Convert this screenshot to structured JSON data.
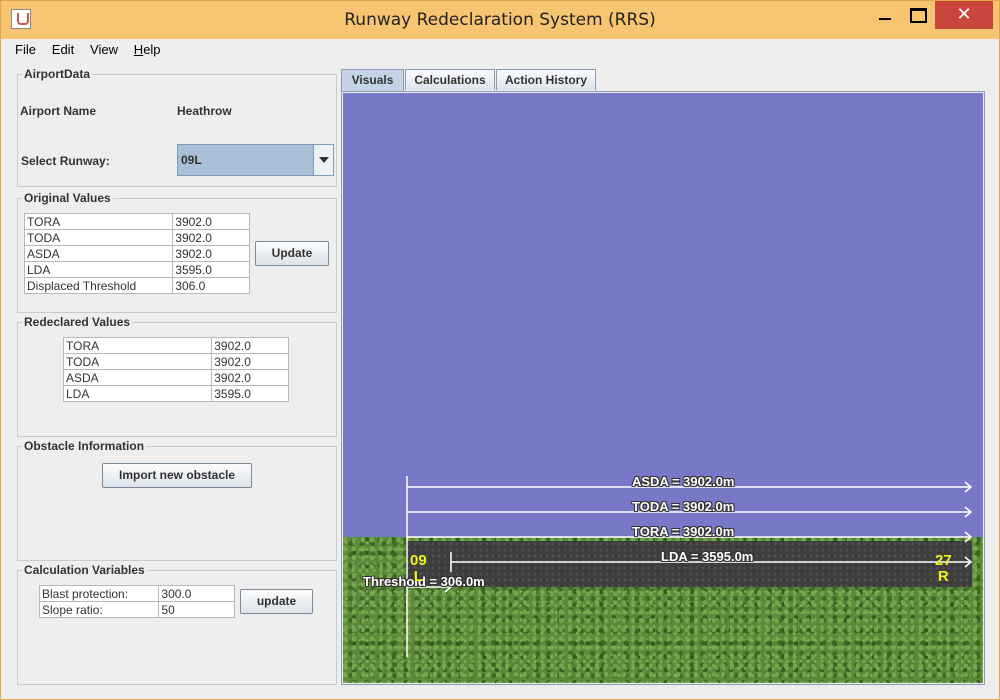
{
  "window": {
    "title": "Runway Redeclaration System (RRS)",
    "close_glyph": "✕"
  },
  "menu": [
    "File",
    "Edit",
    "View",
    "Help"
  ],
  "airport": {
    "legend": "AirportData",
    "name_label": "Airport Name",
    "name_value": "Heathrow",
    "runway_label": "Select Runway:",
    "runway_selected": "09L"
  },
  "original": {
    "legend": "Original Values",
    "rows": [
      {
        "k": "TORA",
        "v": "3902.0"
      },
      {
        "k": "TODA",
        "v": "3902.0"
      },
      {
        "k": "ASDA",
        "v": "3902.0"
      },
      {
        "k": "LDA",
        "v": "3595.0"
      },
      {
        "k": "Displaced Threshold",
        "v": "306.0"
      }
    ],
    "update_label": "Update"
  },
  "redeclared": {
    "legend": "Redeclared Values",
    "rows": [
      {
        "k": "TORA",
        "v": "3902.0"
      },
      {
        "k": "TODA",
        "v": "3902.0"
      },
      {
        "k": "ASDA",
        "v": "3902.0"
      },
      {
        "k": "LDA",
        "v": "3595.0"
      }
    ]
  },
  "obstacle": {
    "legend": "Obstacle Information",
    "import_label": "Import new obstacle"
  },
  "calc_vars": {
    "legend": "Calculation Variables",
    "rows": [
      {
        "k": "Blast protection:",
        "v": "300.0"
      },
      {
        "k": "Slope ratio:",
        "v": "50"
      }
    ],
    "update_label": "update"
  },
  "tabs": [
    "Visuals",
    "Calculations",
    "Action History"
  ],
  "active_tab": "Visuals",
  "visual": {
    "asda_label": "ASDA = 3902.0m",
    "toda_label": "TODA = 3902.0m",
    "tora_label": "TORA = 3902.0m",
    "lda_label": "LDA = 3595.0m",
    "threshold_label": "Threshold = 306.0m",
    "runway_left_num": "09",
    "runway_left_letter": "L",
    "runway_right_num": "27",
    "runway_right_letter": "R",
    "colors": {
      "sky": "#7878c9",
      "grass": "#5d8a3a",
      "runway": "#3d3d3d",
      "runway_id": "#f0f020"
    }
  }
}
